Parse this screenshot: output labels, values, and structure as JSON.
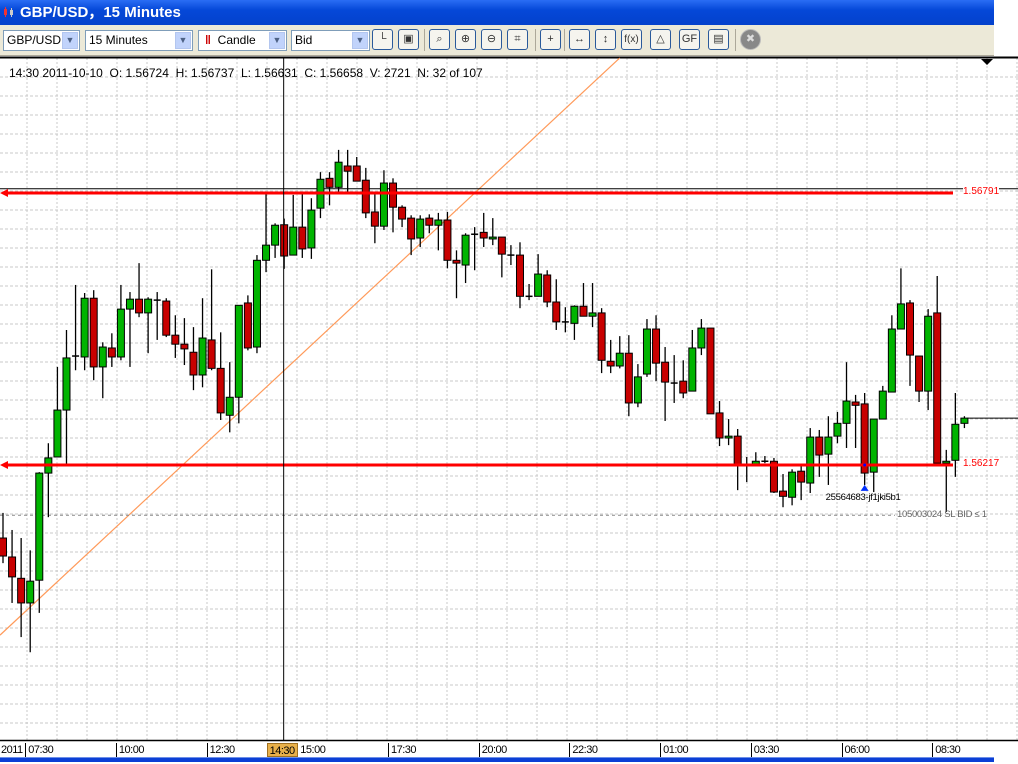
{
  "window": {
    "title": "GBP/USD，15 Minutes"
  },
  "toolbar": {
    "symbol": "GBP/USD",
    "timeframe": "15 Minutes",
    "chart_type": "Candle",
    "price_side": "Bid",
    "buttons": [
      {
        "icon": "chart-axes-icon",
        "label": ""
      },
      {
        "icon": "lock-icon",
        "label": ""
      },
      {
        "icon": "zoom-fit-icon",
        "label": ""
      },
      {
        "icon": "zoom-in-icon",
        "label": ""
      },
      {
        "icon": "zoom-out-icon",
        "label": ""
      },
      {
        "icon": "zoom-region-icon",
        "label": ""
      },
      {
        "icon": "crosshair-icon",
        "label": ""
      },
      {
        "icon": "horizontal-scroll-icon",
        "label": ""
      },
      {
        "icon": "vertical-scale-icon",
        "label": ""
      },
      {
        "icon": "indicators-icon",
        "label": "f(x)"
      },
      {
        "icon": "shapes-icon",
        "label": ""
      },
      {
        "icon": "fibonacci-icon",
        "label": "GF"
      },
      {
        "icon": "save-chart-icon",
        "label": ""
      },
      {
        "icon": "close-circle-icon",
        "label": ""
      }
    ]
  },
  "info": {
    "text": "14:30 2011-10-10  O: 1.56724  H: 1.56737  L: 1.56631  C: 1.56658  V: 2721  N: 32 of 107"
  },
  "colors": {
    "bull": "#00b400",
    "bear": "#c80000",
    "level": "#ff0000",
    "trend": "#ff9a5a",
    "titlebar": "#0548d8",
    "cursor_label": "#e8b04a"
  },
  "chart_data": {
    "type": "candlestick",
    "interval": "15 Minutes",
    "cursor_bar": 31,
    "candles_ohlc": [
      [
        1.56063,
        1.56116,
        1.5601,
        1.56025
      ],
      [
        1.56023,
        1.5608,
        1.55926,
        1.55981
      ],
      [
        1.55978,
        1.56063,
        1.55854,
        1.55926
      ],
      [
        1.55926,
        1.56037,
        1.55822,
        1.55972
      ],
      [
        1.55974,
        1.56202,
        1.55905,
        1.562
      ],
      [
        1.562,
        1.56263,
        1.56107,
        1.56232
      ],
      [
        1.56234,
        1.56424,
        1.56234,
        1.56333
      ],
      [
        1.56333,
        1.56502,
        1.56217,
        1.56443
      ],
      [
        1.56445,
        1.56597,
        1.56417,
        1.56447
      ],
      [
        1.56445,
        1.5658,
        1.56417,
        1.56569
      ],
      [
        1.56569,
        1.56586,
        1.56396,
        1.56424
      ],
      [
        1.56424,
        1.56476,
        1.56358,
        1.56466
      ],
      [
        1.56464,
        1.56495,
        1.56424,
        1.56445
      ],
      [
        1.56445,
        1.56597,
        1.56438,
        1.56546
      ],
      [
        1.56546,
        1.56582,
        1.56424,
        1.56567
      ],
      [
        1.56567,
        1.56643,
        1.56529,
        1.56538
      ],
      [
        1.56538,
        1.56571,
        1.56453,
        1.56567
      ],
      [
        1.56565,
        1.56582,
        1.56481,
        1.56563
      ],
      [
        1.56563,
        1.56569,
        1.56487,
        1.56491
      ],
      [
        1.56491,
        1.56533,
        1.56443,
        1.56472
      ],
      [
        1.56472,
        1.56527,
        1.56428,
        1.56462
      ],
      [
        1.56455,
        1.56508,
        1.56375,
        1.56407
      ],
      [
        1.56407,
        1.56569,
        1.56381,
        1.56485
      ],
      [
        1.56481,
        1.5663,
        1.56417,
        1.56421
      ],
      [
        1.56421,
        1.56497,
        1.56312,
        1.56327
      ],
      [
        1.56322,
        1.56434,
        1.56286,
        1.5636
      ],
      [
        1.5636,
        1.56554,
        1.56305,
        1.56554
      ],
      [
        1.56559,
        1.56575,
        1.56459,
        1.56464
      ],
      [
        1.56466,
        1.5666,
        1.56453,
        1.56649
      ],
      [
        1.56649,
        1.56793,
        1.56624,
        1.56681
      ],
      [
        1.56681,
        1.56727,
        1.56654,
        1.56723
      ],
      [
        1.56724,
        1.56737,
        1.56631,
        1.56658
      ],
      [
        1.5666,
        1.56787,
        1.5666,
        1.56719
      ],
      [
        1.56719,
        1.56793,
        1.56654,
        1.56673
      ],
      [
        1.56675,
        1.5678,
        1.56652,
        1.56755
      ],
      [
        1.56759,
        1.56835,
        1.56738,
        1.5682
      ],
      [
        1.56822,
        1.56835,
        1.56765,
        1.56803
      ],
      [
        1.56803,
        1.56882,
        1.56793,
        1.56856
      ],
      [
        1.56848,
        1.56882,
        1.56791,
        1.56837
      ],
      [
        1.56848,
        1.56867,
        1.56816,
        1.56816
      ],
      [
        1.56818,
        1.56844,
        1.56738,
        1.56749
      ],
      [
        1.56751,
        1.56793,
        1.56685,
        1.56721
      ],
      [
        1.56721,
        1.56839,
        1.56713,
        1.56812
      ],
      [
        1.56812,
        1.56822,
        1.56708,
        1.56761
      ],
      [
        1.56761,
        1.56765,
        1.56719,
        1.56736
      ],
      [
        1.56738,
        1.56744,
        1.5666,
        1.56694
      ],
      [
        1.56696,
        1.56744,
        1.56677,
        1.56736
      ],
      [
        1.56738,
        1.56746,
        1.56706,
        1.56723
      ],
      [
        1.56723,
        1.56749,
        1.5667,
        1.56734
      ],
      [
        1.56734,
        1.56751,
        1.56632,
        1.56649
      ],
      [
        1.56649,
        1.5667,
        1.56569,
        1.56643
      ],
      [
        1.56639,
        1.56706,
        1.56601,
        1.56702
      ],
      [
        1.56704,
        1.56719,
        1.56628,
        1.56702
      ],
      [
        1.56708,
        1.56749,
        1.56677,
        1.56696
      ],
      [
        1.56694,
        1.56738,
        1.56681,
        1.56698
      ],
      [
        1.56698,
        1.56698,
        1.56613,
        1.56662
      ],
      [
        1.5666,
        1.56681,
        1.56639,
        1.56658
      ],
      [
        1.5666,
        1.56687,
        1.56548,
        1.56573
      ],
      [
        1.56573,
        1.56599,
        1.56565,
        1.56571
      ],
      [
        1.56573,
        1.56662,
        1.56573,
        1.5662
      ],
      [
        1.56618,
        1.56628,
        1.5655,
        1.56561
      ],
      [
        1.56561,
        1.56609,
        1.56502,
        1.56519
      ],
      [
        1.56519,
        1.5655,
        1.56497,
        1.56517
      ],
      [
        1.56516,
        1.56554,
        1.56481,
        1.56552
      ],
      [
        1.56552,
        1.56601,
        1.56531,
        1.56531
      ],
      [
        1.56531,
        1.56601,
        1.56508,
        1.56538
      ],
      [
        1.56538,
        1.56548,
        1.56411,
        1.56438
      ],
      [
        1.56436,
        1.56481,
        1.56411,
        1.56426
      ],
      [
        1.56426,
        1.56489,
        1.56421,
        1.56453
      ],
      [
        1.56453,
        1.56491,
        1.5632,
        1.56348
      ],
      [
        1.56348,
        1.5643,
        1.56339,
        1.56403
      ],
      [
        1.56409,
        1.56525,
        1.56403,
        1.56504
      ],
      [
        1.56504,
        1.56533,
        1.56394,
        1.56432
      ],
      [
        1.56434,
        1.56466,
        1.5631,
        1.56392
      ],
      [
        1.5639,
        1.56449,
        1.56348,
        1.56388
      ],
      [
        1.56394,
        1.56438,
        1.56358,
        1.56369
      ],
      [
        1.56373,
        1.56502,
        1.56373,
        1.56464
      ],
      [
        1.56464,
        1.56525,
        1.56449,
        1.56506
      ],
      [
        1.56506,
        1.56506,
        1.56325,
        1.56325
      ],
      [
        1.56327,
        1.56352,
        1.56257,
        1.56274
      ],
      [
        1.56274,
        1.56314,
        1.56259,
        1.56278
      ],
      [
        1.56278,
        1.56293,
        1.56164,
        1.56217
      ],
      [
        1.56217,
        1.56234,
        1.56181,
        1.56215
      ],
      [
        1.56215,
        1.56244,
        1.56215,
        1.56225
      ],
      [
        1.56225,
        1.56236,
        1.56221,
        1.56223
      ],
      [
        1.56225,
        1.56232,
        1.56158,
        1.5616
      ],
      [
        1.56162,
        1.56198,
        1.56128,
        1.56151
      ],
      [
        1.56149,
        1.56208,
        1.56132,
        1.56202
      ],
      [
        1.56204,
        1.56219,
        1.56143,
        1.56181
      ],
      [
        1.56179,
        1.56295,
        1.56158,
        1.56276
      ],
      [
        1.56276,
        1.56291,
        1.56192,
        1.56238
      ],
      [
        1.5624,
        1.5632,
        1.56175,
        1.56276
      ],
      [
        1.56278,
        1.56329,
        1.56263,
        1.56305
      ],
      [
        1.56305,
        1.56434,
        1.56253,
        1.56352
      ],
      [
        1.5635,
        1.56365,
        1.56253,
        1.56343
      ],
      [
        1.56346,
        1.56369,
        1.56175,
        1.562
      ],
      [
        1.56202,
        1.56314,
        1.5616,
        1.56314
      ],
      [
        1.56314,
        1.56384,
        1.56314,
        1.56373
      ],
      [
        1.56371,
        1.56533,
        1.56371,
        1.56504
      ],
      [
        1.56504,
        1.56632,
        1.56504,
        1.56557
      ],
      [
        1.56559,
        1.56565,
        1.56384,
        1.56449
      ],
      [
        1.56447,
        1.56447,
        1.5635,
        1.56373
      ],
      [
        1.56373,
        1.56546,
        1.56333,
        1.56531
      ],
      [
        1.56538,
        1.56616,
        1.56221,
        1.56221
      ],
      [
        1.56221,
        1.56249,
        1.56118,
        1.56225
      ],
      [
        1.56227,
        1.56369,
        1.56192,
        1.56303
      ],
      [
        1.56305,
        1.5632,
        1.56295,
        1.56316
      ]
    ],
    "x_ticks": [
      {
        "label": "2011",
        "bar": -1
      },
      {
        "label": "07:30",
        "bar": 3
      },
      {
        "label": "10:00",
        "bar": 13
      },
      {
        "label": "12:30",
        "bar": 23
      },
      {
        "label": "15:00",
        "bar": 33
      },
      {
        "label": "17:30",
        "bar": 43
      },
      {
        "label": "20:00",
        "bar": 53
      },
      {
        "label": "22:30",
        "bar": 63
      },
      {
        "label": "01:00",
        "bar": 73
      },
      {
        "label": "03:30",
        "bar": 83
      },
      {
        "label": "06:00",
        "bar": 93
      },
      {
        "label": "08:30",
        "bar": 103
      }
    ],
    "cursor_time_label": "14:30",
    "levels": [
      {
        "price": 1.56791,
        "label": "1.56791",
        "color": "#ff0000"
      },
      {
        "price": 1.56217,
        "label": "1.56217",
        "color": "#ff0000"
      }
    ],
    "level_line_black": 1.568,
    "current_price": 1.56316,
    "order_line": {
      "price": 1.56111,
      "label": "105003024 SL BID ≤ 1"
    },
    "trade_marker": {
      "bar": 95,
      "price": 1.56173,
      "label": "25564683-jf1jki5b1"
    },
    "trendline": {
      "from_bar": 0,
      "from_price": 1.55864,
      "to_bar": 68,
      "to_price": 1.57076
    },
    "grid": true
  }
}
